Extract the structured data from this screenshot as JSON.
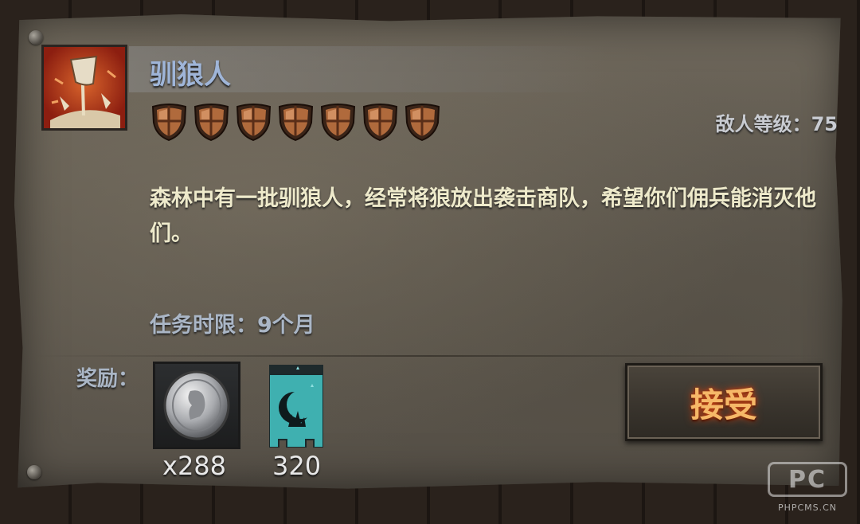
{
  "quest": {
    "title": "驯狼人",
    "difficulty_shields": 7,
    "enemy_level_text": "敌人等级：75",
    "description": "森林中有一批驯狼人，经常将狼放出袭击商队，希望你们佣兵能消灭他们。",
    "time_limit_text": "任务时限：9个月",
    "icon": "wolf-banner-icon"
  },
  "rewards": {
    "label": "奖励：",
    "items": [
      {
        "icon": "silver-coin-icon",
        "count": "x288"
      },
      {
        "icon": "crescent-banner-icon",
        "count": "320"
      }
    ]
  },
  "actions": {
    "accept_label": "接受"
  },
  "watermark": {
    "logo": "PC",
    "text": "PHPCMS.CN"
  },
  "colors": {
    "title": "#9fb5d8",
    "accept_glow": "#f6b868",
    "shield": "#b06a3c",
    "banner": "#3fb0b0"
  }
}
